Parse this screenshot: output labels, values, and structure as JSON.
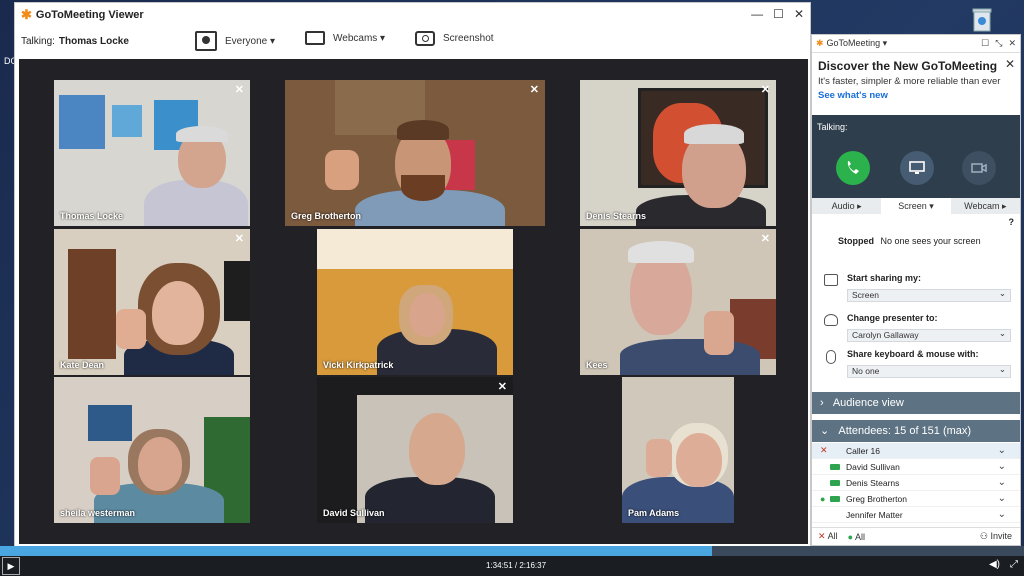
{
  "desktop": {
    "label": "DO"
  },
  "viewer": {
    "title": "GoToMeeting Viewer",
    "talking_label": "Talking:",
    "talking_name": "Thomas Locke",
    "toolbar": {
      "everyone": "Everyone ▾",
      "webcams": "Webcams ▾",
      "screenshot": "Screenshot"
    }
  },
  "participants": [
    "Thomas Locke",
    "Greg Brotherton",
    "Denis Stearns",
    "Kate Dean",
    "Vicki Kirkpatrick",
    "Kees",
    "sheila westerman",
    "David Sullivan",
    "Pam Adams"
  ],
  "panel": {
    "title": "GoToMeeting ▾",
    "promo_title": "Discover the New GoToMeeting",
    "promo_text": "It's faster, simpler & more reliable than ever",
    "promo_link": "See what's new",
    "talking": "Talking:",
    "tabs": [
      "Audio ▸",
      "Screen ▾",
      "Webcam ▸"
    ],
    "help": "?",
    "status_bold": "Stopped",
    "status_text": "No one sees your screen",
    "start_sharing": "Start sharing my:",
    "start_sharing_value": "Screen",
    "change_presenter": "Change presenter to:",
    "change_presenter_value": "Carolyn Gallaway",
    "share_kb": "Share keyboard & mouse with:",
    "share_kb_value": "No one",
    "audience": "Audience view",
    "attendees": "Attendees:  15 of 151 (max)",
    "attendee_list": [
      "Caller 16",
      "David Sullivan",
      "Denis Stearns",
      "Greg Brotherton",
      "Jennifer Matter"
    ],
    "footer_all1": "All",
    "footer_all2": "All",
    "invite": "Invite"
  },
  "player": {
    "time": "1:34:51 / 2:16:37",
    "progress": 0.695
  }
}
